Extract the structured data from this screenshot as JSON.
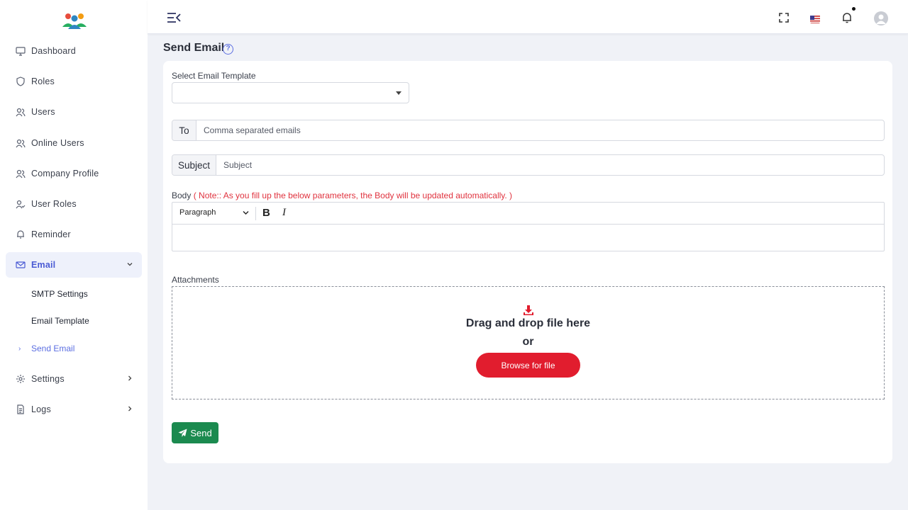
{
  "sidebar": {
    "items": [
      {
        "label": "Dashboard"
      },
      {
        "label": "Roles"
      },
      {
        "label": "Users"
      },
      {
        "label": "Online Users"
      },
      {
        "label": "Company Profile"
      },
      {
        "label": "User Roles"
      },
      {
        "label": "Reminder"
      },
      {
        "label": "Email"
      }
    ],
    "email_sub": [
      {
        "label": "SMTP Settings"
      },
      {
        "label": "Email Template"
      },
      {
        "label": "Send Email"
      }
    ],
    "bottom_items": [
      {
        "label": "Settings"
      },
      {
        "label": "Logs"
      }
    ]
  },
  "page": {
    "title": "Send Email",
    "help": "?"
  },
  "form": {
    "template_label": "Select Email Template",
    "template_value": "",
    "to_addon": "To",
    "to_placeholder": "Comma separated emails",
    "subject_addon": "Subject",
    "subject_placeholder": "Subject",
    "body_label": "Body",
    "body_note": "( Note:: As you fill up the below parameters, the Body will be updated automatically. )",
    "paragraph_label": "Paragraph",
    "bold_label": "B",
    "italic_label": "I",
    "attachments_label": "Attachments",
    "drag_text": "Drag and drop file here",
    "or_text": "or",
    "browse_label": "Browse for file",
    "send_label": "Send"
  },
  "colors": {
    "accent": "#5b6ee1",
    "danger": "#e11d2e",
    "success": "#1b8a4f"
  }
}
